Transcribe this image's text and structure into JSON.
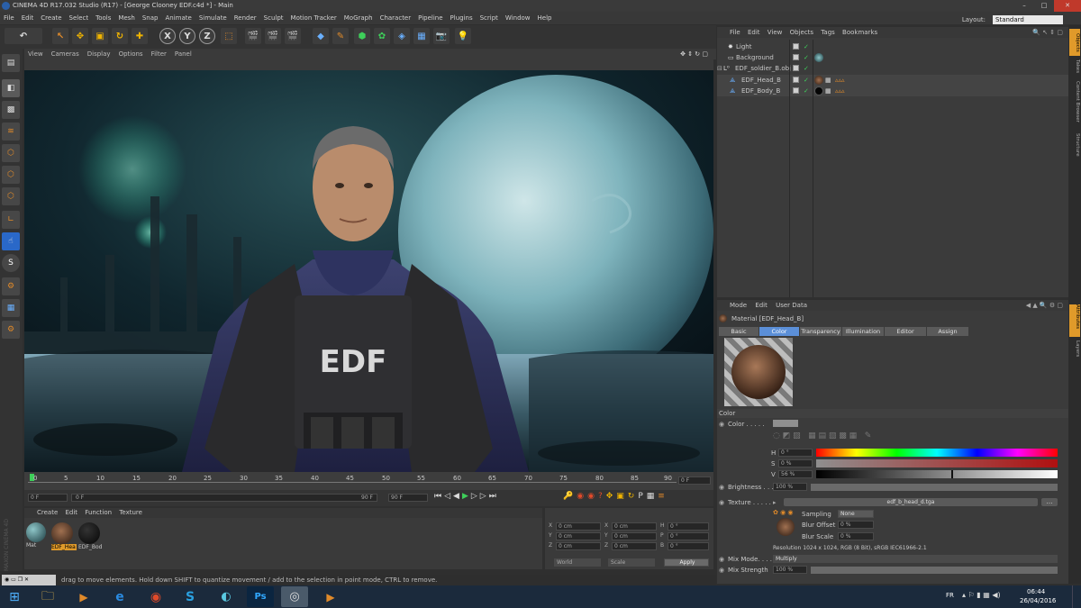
{
  "window": {
    "title": "CINEMA 4D R17.032 Studio (R17) - [George Clooney EDF.c4d *] - Main"
  },
  "menu": [
    "File",
    "Edit",
    "Create",
    "Select",
    "Tools",
    "Mesh",
    "Snap",
    "Animate",
    "Simulate",
    "Render",
    "Sculpt",
    "Motion Tracker",
    "MoGraph",
    "Character",
    "Pipeline",
    "Plugins",
    "Script",
    "Window",
    "Help"
  ],
  "layout": {
    "label": "Layout:",
    "value": "Standard"
  },
  "viewport": {
    "menu": [
      "View",
      "Cameras",
      "Display",
      "Options",
      "Filter",
      "Panel"
    ],
    "chest_text": "EDF"
  },
  "timeline": {
    "ticks": [
      "0",
      "5",
      "10",
      "15",
      "20",
      "25",
      "30",
      "35",
      "40",
      "45",
      "50",
      "55",
      "60",
      "65",
      "70",
      "75",
      "80",
      "85",
      "90"
    ],
    "end_frame": "0 F"
  },
  "transport": {
    "start": "0 F",
    "current": "0 F",
    "end": "90 F",
    "max": "90 F"
  },
  "material_manager": {
    "menu": [
      "Create",
      "Edit",
      "Function",
      "Texture"
    ],
    "materials": [
      "Mat",
      "EDF_Hea",
      "EDF_Bod"
    ]
  },
  "coordinates": {
    "rows": [
      [
        "X",
        "0 cm",
        "X",
        "0 cm",
        "H",
        "0 °"
      ],
      [
        "Y",
        "0 cm",
        "Y",
        "0 cm",
        "P",
        "0 °"
      ],
      [
        "Z",
        "0 cm",
        "Z",
        "0 cm",
        "B",
        "0 °"
      ]
    ],
    "world": "World",
    "scale": "Scale",
    "apply": "Apply"
  },
  "status": "drag to move elements. Hold down SHIFT to quantize movement / add to the selection in point mode, CTRL to remove.",
  "object_manager": {
    "menu": [
      "File",
      "Edit",
      "View",
      "Objects",
      "Tags",
      "Bookmarks"
    ],
    "objects": [
      {
        "name": "Light",
        "indent": 1
      },
      {
        "name": "Background",
        "indent": 1
      },
      {
        "name": "EDF_soldier_B.obj",
        "indent": 0
      },
      {
        "name": "EDF_Head_B",
        "indent": 2
      },
      {
        "name": "EDF_Body_B",
        "indent": 2
      }
    ]
  },
  "attributes": {
    "menu": [
      "Mode",
      "Edit",
      "User Data"
    ],
    "material_title": "Material [EDF_Head_B]",
    "tabs": [
      "Basic",
      "Color",
      "Transparency",
      "Illumination",
      "Editor",
      "Assign"
    ],
    "section": "Color",
    "color_label": "Color . . . . .",
    "h_label": "H",
    "h_value": "0 °",
    "s_label": "S",
    "s_value": "0 %",
    "v_label": "V",
    "v_value": "56 %",
    "brightness_label": "Brightness . . .",
    "brightness_value": "100 %",
    "texture_label": "Texture . . . . .",
    "texture_file": "edf_b_head_d.tga",
    "sampling_label": "Sampling",
    "sampling_value": "None",
    "blur_offset_label": "Blur Offset",
    "blur_offset_value": "0 %",
    "blur_scale_label": "Blur Scale",
    "blur_scale_value": "0 %",
    "resolution": "Resolution 1024 x 1024, RGB (8 Bit), sRGB IEC61966-2.1",
    "mix_mode_label": "Mix Mode. . . . .",
    "mix_mode_value": "Multiply",
    "mix_strength_label": "Mix Strength",
    "mix_strength_value": "100 %"
  },
  "right_strip": [
    "Objects",
    "Takes",
    "Content Browser",
    "Structure"
  ],
  "right_strip2": [
    "Attributes",
    "Layers"
  ],
  "taskbar": {
    "lang": "FR",
    "time": "06:44",
    "date": "26/04/2016"
  }
}
